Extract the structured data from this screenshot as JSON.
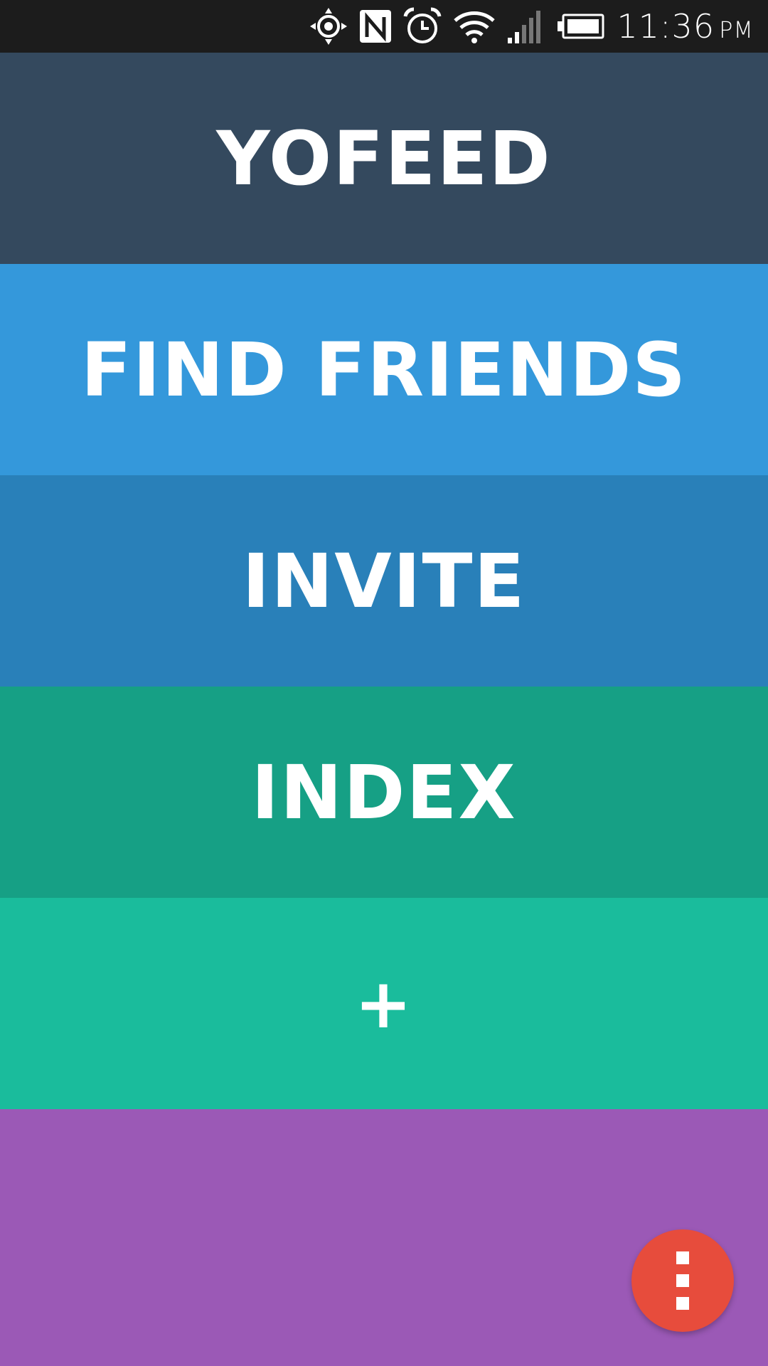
{
  "status_bar": {
    "time": "11:36",
    "ampm": "PM",
    "icons": [
      "gps-icon",
      "nfc-icon",
      "alarm-icon",
      "wifi-icon",
      "signal-icon",
      "battery-icon"
    ],
    "background": "#1c1c1c"
  },
  "menu": {
    "items": [
      {
        "label": "YOFEED",
        "color": "#34495e"
      },
      {
        "label": "FIND FRIENDS",
        "color": "#3498db"
      },
      {
        "label": "INVITE",
        "color": "#2980b9"
      },
      {
        "label": "INDEX",
        "color": "#16a085"
      },
      {
        "label": "+",
        "color": "#1abc9c"
      }
    ]
  },
  "bottom": {
    "color": "#9b59b6"
  },
  "fab": {
    "icon": "more-vertical-icon",
    "color": "#e74c3c"
  }
}
